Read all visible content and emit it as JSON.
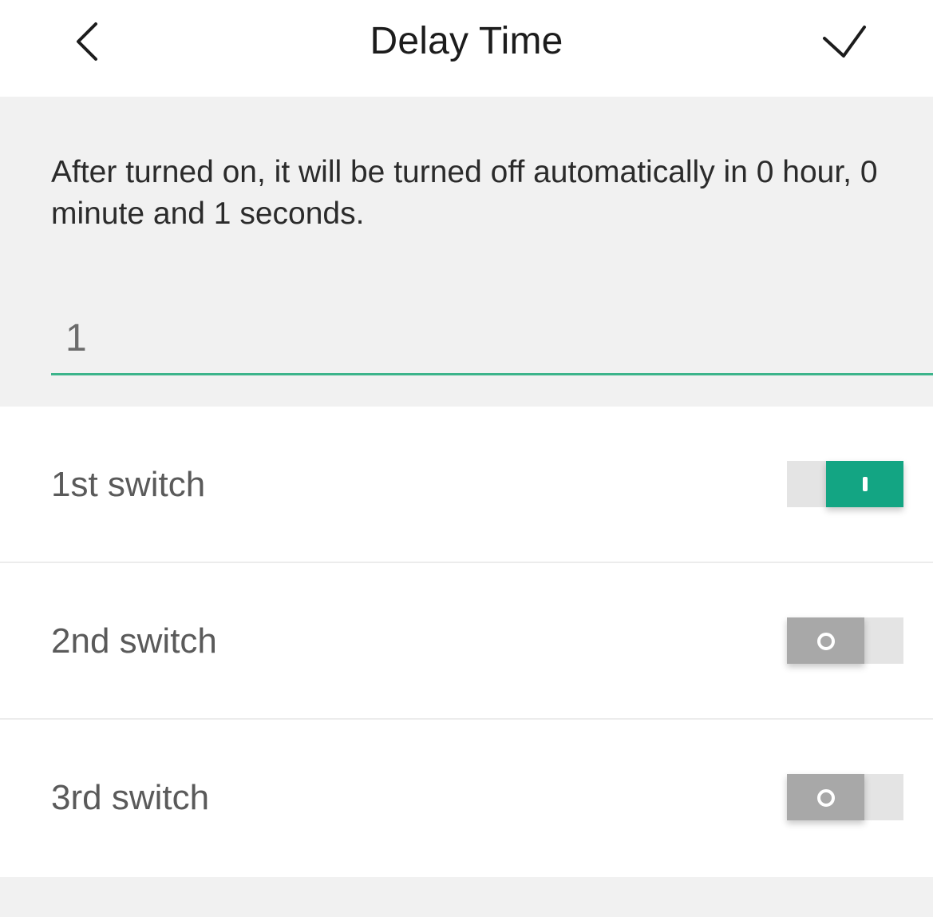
{
  "header": {
    "title": "Delay Time",
    "back_icon": "chevron-left-icon",
    "confirm_icon": "checkmark-icon"
  },
  "description": "After turned on, it will be turned off automatically in 0 hour, 0 minute and 1 seconds.",
  "delay_input": {
    "value": "1"
  },
  "switches": [
    {
      "label": "1st switch",
      "state": "on"
    },
    {
      "label": "2nd switch",
      "state": "off"
    },
    {
      "label": "3rd switch",
      "state": "off"
    }
  ],
  "colors": {
    "accent": "#13a583",
    "input_underline": "#3cb48b",
    "toggle_off_knob": "#a8a8a8",
    "toggle_track": "#e4e4e4",
    "background_gray": "#f1f1f1"
  }
}
